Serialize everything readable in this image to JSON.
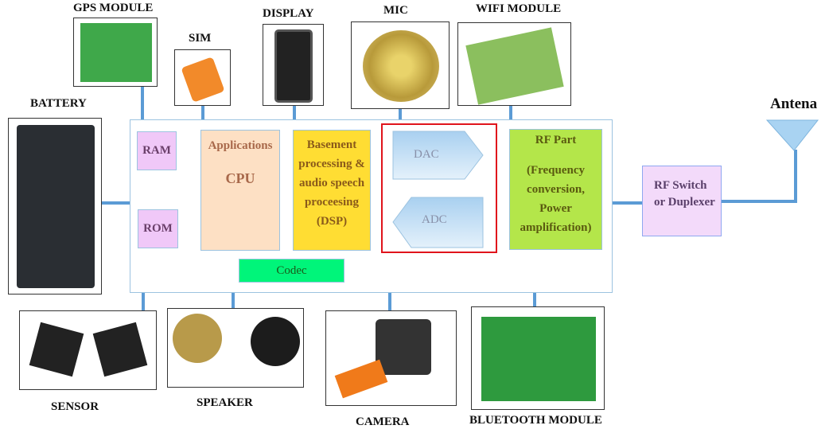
{
  "blocks": {
    "ram": "RAM",
    "rom": "ROM",
    "cpu_top": "Applications",
    "cpu": "CPU",
    "dsp": "Basement processing & audio speech proceesing (DSP)",
    "dac": "DAC",
    "adc": "ADC",
    "rf_title": "RF Part",
    "rf_body": "(Frequency conversion, Power amplification)",
    "codec": "Codec",
    "rf_switch": "RF Switch or Duplexer"
  },
  "labels": {
    "gps": "GPS MODULE",
    "sim": "SIM",
    "display": "DISPLAY",
    "mic": "MIC",
    "wifi": "WIFI MODULE",
    "battery": "BATTERY",
    "antenna": "Antena",
    "sensor": "SENSOR",
    "speaker": "SPEAKER",
    "camera": "CAMERA",
    "bluetooth": "BLUETOOTH MODULE"
  },
  "colors": {
    "line": "#5b9bd5",
    "ram": "#f0c8f8",
    "cpu": "#fde0c4",
    "dsp": "#ffdd33",
    "dac": "#bcdcf4",
    "rf": "#b4e64a",
    "codec": "#00f57a",
    "highlight": "#e0141c"
  }
}
